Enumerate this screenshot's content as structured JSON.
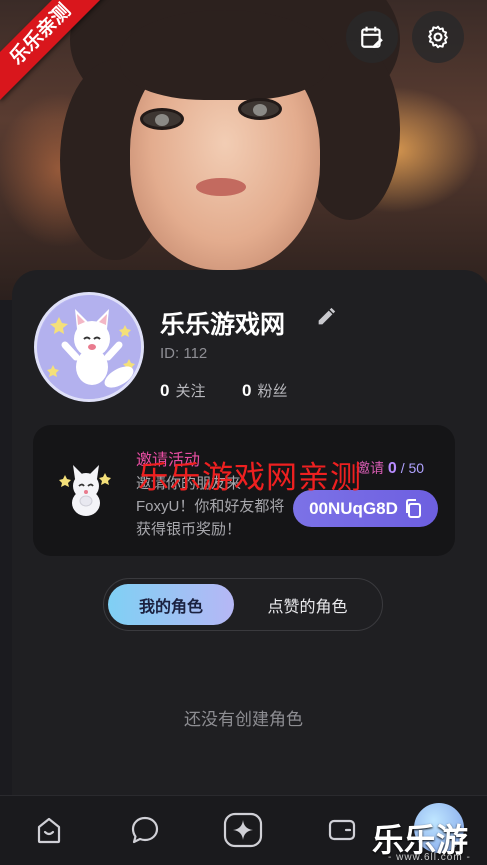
{
  "badge": "乐乐亲测",
  "profile": {
    "name": "乐乐游戏网",
    "id_text": "ID: 112",
    "following_count": "0",
    "following_label": "关注",
    "followers_count": "0",
    "followers_label": "粉丝"
  },
  "invite": {
    "title": "邀请活动",
    "description": "邀请你的朋友来FoxyU！你和好友都将获得银币奖励！",
    "count_label": "邀请",
    "count_current": "0",
    "count_total": "/ 50",
    "code": "00NUqG8D"
  },
  "watermark": "乐乐游戏网亲测",
  "tabs": {
    "mine": "我的角色",
    "liked": "点赞的角色"
  },
  "empty_text": "还没有创建角色",
  "corner_mark": {
    "title": "乐乐游戏",
    "sub": "- www.6ll.com -"
  },
  "colors": {
    "accent": "#7c72e7",
    "invite_title": "#e84ea3",
    "ribbon": "#d9161c"
  }
}
